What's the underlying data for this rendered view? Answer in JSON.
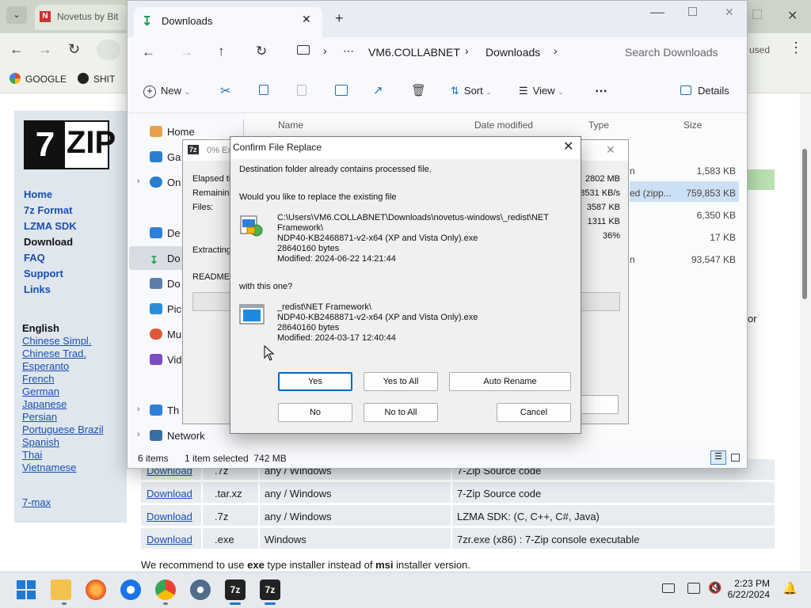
{
  "browser": {
    "tab_title": "Novetus by Bit",
    "tab_favicon": "N",
    "bookmarks": [
      {
        "label": "GOOGLE",
        "icon": "google-icon"
      },
      {
        "label": "SHIT",
        "icon": "steam-icon"
      }
    ],
    "profile_badge": "used"
  },
  "site": {
    "logo": "7ZIP",
    "nav": [
      "Home",
      "7z Format",
      "LZMA SDK",
      "Download",
      "FAQ",
      "Support",
      "Links"
    ],
    "current_nav": "Download",
    "lang_header": "English",
    "languages": [
      "Chinese Simpl.",
      "Chinese Trad.",
      "Esperanto",
      "French",
      "German",
      "Japanese",
      "Persian",
      "Portuguese Brazil",
      "Spanish",
      "Thai",
      "Vietnamese"
    ],
    "extra_link": "7-max",
    "downloads": [
      {
        "link": "Download",
        "type": ".7z",
        "os": "any / Windows",
        "desc": "7-Zip Source code"
      },
      {
        "link": "Download",
        "type": ".tar.xz",
        "os": "any / Windows",
        "desc": "7-Zip Source code"
      },
      {
        "link": "Download",
        "type": ".7z",
        "os": "any / Windows",
        "desc": "LZMA SDK: (C, C++, C#, Java)"
      },
      {
        "link": "Download",
        "type": ".exe",
        "os": "Windows",
        "desc": "7zr.exe (x86) : 7-Zip console executable"
      }
    ],
    "recommend_pre": "We recommend to use ",
    "recommend_b1": "exe",
    "recommend_mid": " type installer instead of ",
    "recommend_b2": "msi",
    "recommend_post": " installer version.",
    "right_fragment": "or"
  },
  "explorer": {
    "tab_title": "Downloads",
    "breadcrumb": [
      "VM6.COLLABNET",
      "Downloads"
    ],
    "search_placeholder": "Search Downloads",
    "cmd": {
      "new": "New",
      "sort": "Sort",
      "view": "View",
      "details": "Details"
    },
    "nav": [
      "Home",
      "Ga",
      "On",
      "De",
      "Do",
      "Do",
      "Pic",
      "Mu",
      "Vid",
      "Th",
      "Network"
    ],
    "columns": {
      "name": "Name",
      "date": "Date modified",
      "type": "Type",
      "size": "Size"
    },
    "rows": [
      {
        "type": "n",
        "size": "1,583 KB"
      },
      {
        "type": "ed (zipp...",
        "size": "759,853 KB"
      },
      {
        "type": "",
        "size": "6,350 KB"
      },
      {
        "type": "",
        "size": "17 KB"
      },
      {
        "type": "n",
        "size": "93,547 KB"
      }
    ],
    "status": {
      "items": "6 items",
      "selected": "1 item selected  742 MB"
    }
  },
  "progress": {
    "title": "0% Ex",
    "labels": [
      "Elapsed ti",
      "Remaining",
      "Files:"
    ],
    "values": [
      "2802 MB",
      "8531 KB/s",
      "3587 KB",
      "1311 KB",
      "36%"
    ],
    "extracting": "Extracting",
    "current_file": "README-"
  },
  "dialog": {
    "title": "Confirm File Replace",
    "msg1": "Destination folder already contains processed file.",
    "msg2": "Would you like to replace the existing file",
    "existing": {
      "path1": "C:\\Users\\VM6.COLLABNET\\Downloads\\novetus-windows\\_redist\\NET",
      "path2": "Framework\\",
      "name": "NDP40-KB2468871-v2-x64 (XP and Vista Only).exe",
      "size": "28640160 bytes",
      "modified": "Modified: 2024-06-22 14:21:44"
    },
    "with_this": "with this one?",
    "new": {
      "path1": "_redist\\NET Framework\\",
      "name": "NDP40-KB2468871-v2-x64 (XP and Vista Only).exe",
      "size": "28640160 bytes",
      "modified": "Modified: 2024-03-17 12:40:44"
    },
    "buttons": {
      "yes": "Yes",
      "yes_all": "Yes to All",
      "auto_rename": "Auto Rename",
      "no": "No",
      "no_all": "No to All",
      "cancel": "Cancel"
    }
  },
  "taskbar": {
    "time": "2:23 PM",
    "date": "6/22/2024",
    "zip_label": "7z"
  }
}
